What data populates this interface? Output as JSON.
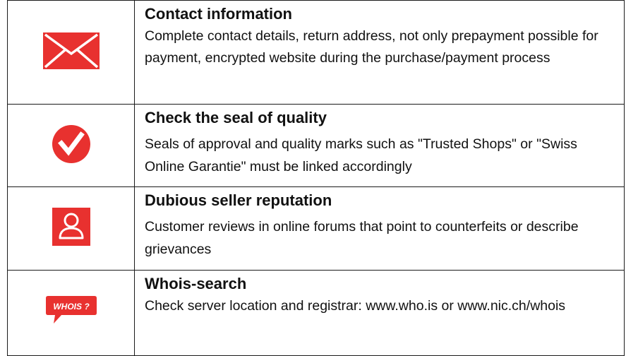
{
  "rows": [
    {
      "icon": "envelope-icon",
      "title": "Contact information",
      "description": "Complete contact details, return address, not only prepayment possible for payment, encrypted website during the purchase/payment process"
    },
    {
      "icon": "checkmark-seal-icon",
      "title": "Check the seal of quality",
      "description": "Seals of approval and quality marks such as \"Trusted Shops\" or \"Swiss Online Garantie\" must be linked accordingly"
    },
    {
      "icon": "user-icon",
      "title": "Dubious seller reputation",
      "description": "Customer reviews in online forums that point to counterfeits or describe grievances"
    },
    {
      "icon": "whois-speech-bubble-icon",
      "icon_text": "WHOIS ?",
      "title": "Whois-search",
      "description": "Check server location and registrar: www.who.is or www.nic.ch/whois"
    }
  ],
  "colors": {
    "icon_red": "#e8312f",
    "border": "#1a1a1a",
    "text": "#111111"
  }
}
